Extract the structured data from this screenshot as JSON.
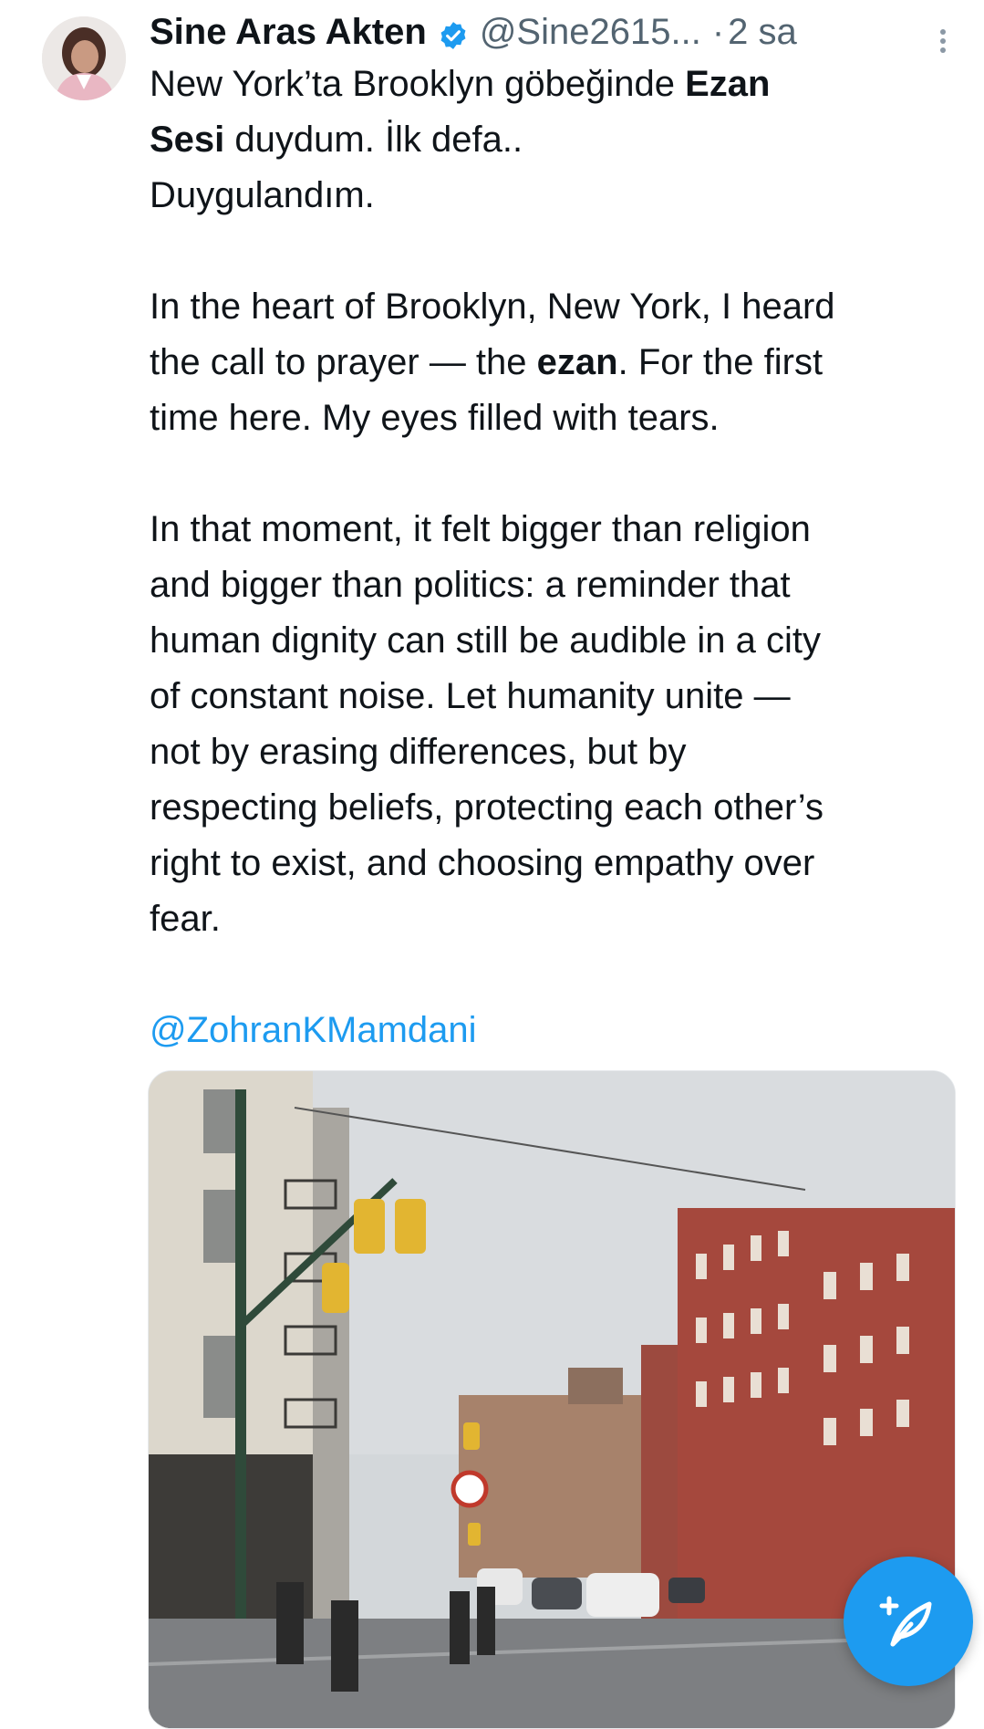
{
  "tweet": {
    "author": {
      "display_name": "Sine Aras Akten",
      "handle": "@Sine2615...",
      "verified": true,
      "avatar": "profile-photo"
    },
    "separator": "·",
    "time": "2 sa",
    "text": {
      "line1_prefix": "New York’ta  Brooklyn göbeğinde ",
      "line1_bold": "Ezan",
      "line2_bold": "Sesi",
      "line2_rest": " duydum. İlk defa..",
      "line3": "Duygulandım.",
      "p2_lines": [
        "In the heart of Brooklyn, New York, I heard",
        "the call to prayer — the ",
        "ezan",
        ". For the first",
        "time here. My eyes filled with tears."
      ],
      "p3_lines": [
        "In that moment, it felt bigger than religion",
        "and bigger than politics: a reminder that",
        "human dignity can still be audible in a city",
        "of constant noise. Let humanity unite —",
        "not by erasing differences, but by",
        "respecting beliefs, protecting each other’s",
        "right to exist, and choosing empathy over",
        "fear."
      ],
      "mention": "@ZohranKMamdani"
    },
    "media": {
      "type": "video-thumbnail",
      "description_icon": "street-scene-image"
    }
  },
  "icons": {
    "verified": "verified-badge-icon",
    "more": "more-vertical-icon",
    "compose": "compose-post-icon"
  },
  "colors": {
    "accent": "#1d9bf0",
    "text": "#0f1419",
    "secondary_text": "#536471",
    "background": "#ffffff"
  }
}
